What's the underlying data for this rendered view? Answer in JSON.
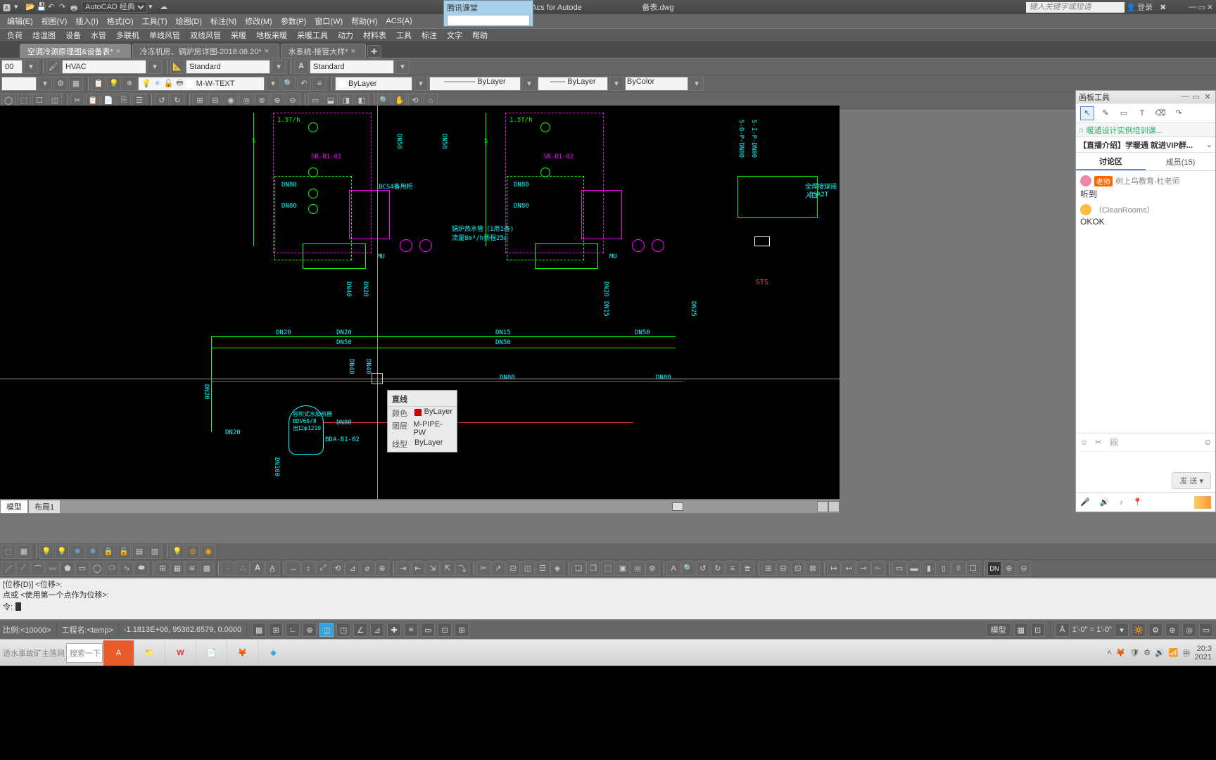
{
  "title_center": "HyAcs for Autode",
  "title_file_tail": "备表.dwg",
  "tencent_title": "腾讯课堂",
  "workspace_label": "AutoCAD 经典",
  "search_placeholder": "键入关键字或短语",
  "login_label": "登录",
  "menu": [
    "编辑(E)",
    "视图(V)",
    "插入(I)",
    "格式(O)",
    "工具(T)",
    "绘图(D)",
    "标注(N)",
    "修改(M)",
    "参数(P)",
    "窗口(W)",
    "帮助(H)",
    "ACS(A)"
  ],
  "ribbon": [
    "负荷",
    "焓湿图",
    "设备",
    "水管",
    "多联机",
    "单线风管",
    "双线风管",
    "采暖",
    "地板采暖",
    "采暖工具",
    "动力",
    "材料表",
    "工具",
    "标注",
    "文字",
    "帮助"
  ],
  "doc_tabs": [
    {
      "label": "空调冷源原理图&设备表*",
      "active": true
    },
    {
      "label": "冷冻机房、锅炉房详图-2018.08.20*",
      "active": false
    },
    {
      "label": "水系统-接管大样*",
      "active": false
    }
  ],
  "row1": {
    "num": "00",
    "layer_filter": "HVAC",
    "dim_style": "Standard",
    "text_style": "Standard"
  },
  "row2": {
    "layer": "M-W-TEXT",
    "color": "ByLayer",
    "ltype": "ByLayer",
    "lweight": "ByLayer",
    "plot": "ByColor"
  },
  "tooltip": {
    "title": "直线",
    "rows": [
      {
        "k": "颜色",
        "v": "ByLayer",
        "swatch": true
      },
      {
        "k": "图层",
        "v": "M-PIPE-PW"
      },
      {
        "k": "线型",
        "v": "ByLayer"
      }
    ]
  },
  "model_tabs": [
    "模型",
    "布局1"
  ],
  "cmd_history": [
    "[位移(D)] <位移>:",
    "点或 <使用第一个点作为位移>:"
  ],
  "cmd_prompt": "令:",
  "status": {
    "scale": "比例:<10000>",
    "project": "工程名:<temp>",
    "coords": "-1.1813E+06, 95362.6579, 0.0000",
    "annoscale": "1'-0\" = 1'-0\"",
    "model_btn": "模型"
  },
  "taskbar": {
    "watermark": "透水事故矿主落网",
    "search": "搜索一下",
    "time": "20:3",
    "date": "2021"
  },
  "side": {
    "title": "画板工具",
    "crumb": "暖通设计实例培训课...",
    "banner": "【直播介绍】学暖通 就进VIP群...",
    "tabs": [
      {
        "label": "讨论区",
        "active": true
      },
      {
        "label": "成员(15)",
        "active": false
      }
    ],
    "messages": [
      {
        "tag": "老师",
        "name": "树上鸟教育-杜老师",
        "text": "听到",
        "avatar": "a1"
      },
      {
        "tag": "",
        "name": "（CleanRooms）",
        "text": "OKOK",
        "avatar": "a2"
      }
    ],
    "send": "发 送"
  },
  "dwg_labels": {
    "flow1": "1.5T/h",
    "flow2": "1.5T/h",
    "sb1": "SB-B1-01",
    "sb2": "SB-B1-02",
    "dn80": "DN80",
    "dn50": "DN50",
    "dn40": "DN40",
    "dn20": "DN20",
    "dn25": "DN25",
    "dn15": "DN15",
    "dn100": "DN100",
    "bcs": "BCS4备用柜",
    "mu": "MU",
    "sts": "STS",
    "bda": "BDA-B1-02",
    "bdv": "容积式水加热器\nBDV60/8\n出口φ1210",
    "bsa": "BSA2T",
    "pump_note": "锅炉热水管（1用1备)\n流量8m³/h扬程25m",
    "s": "S",
    "s3": "S-O-P-DN80",
    "s4": "S-I-P-DN80",
    "valve": "全焊接球阀入口"
  }
}
